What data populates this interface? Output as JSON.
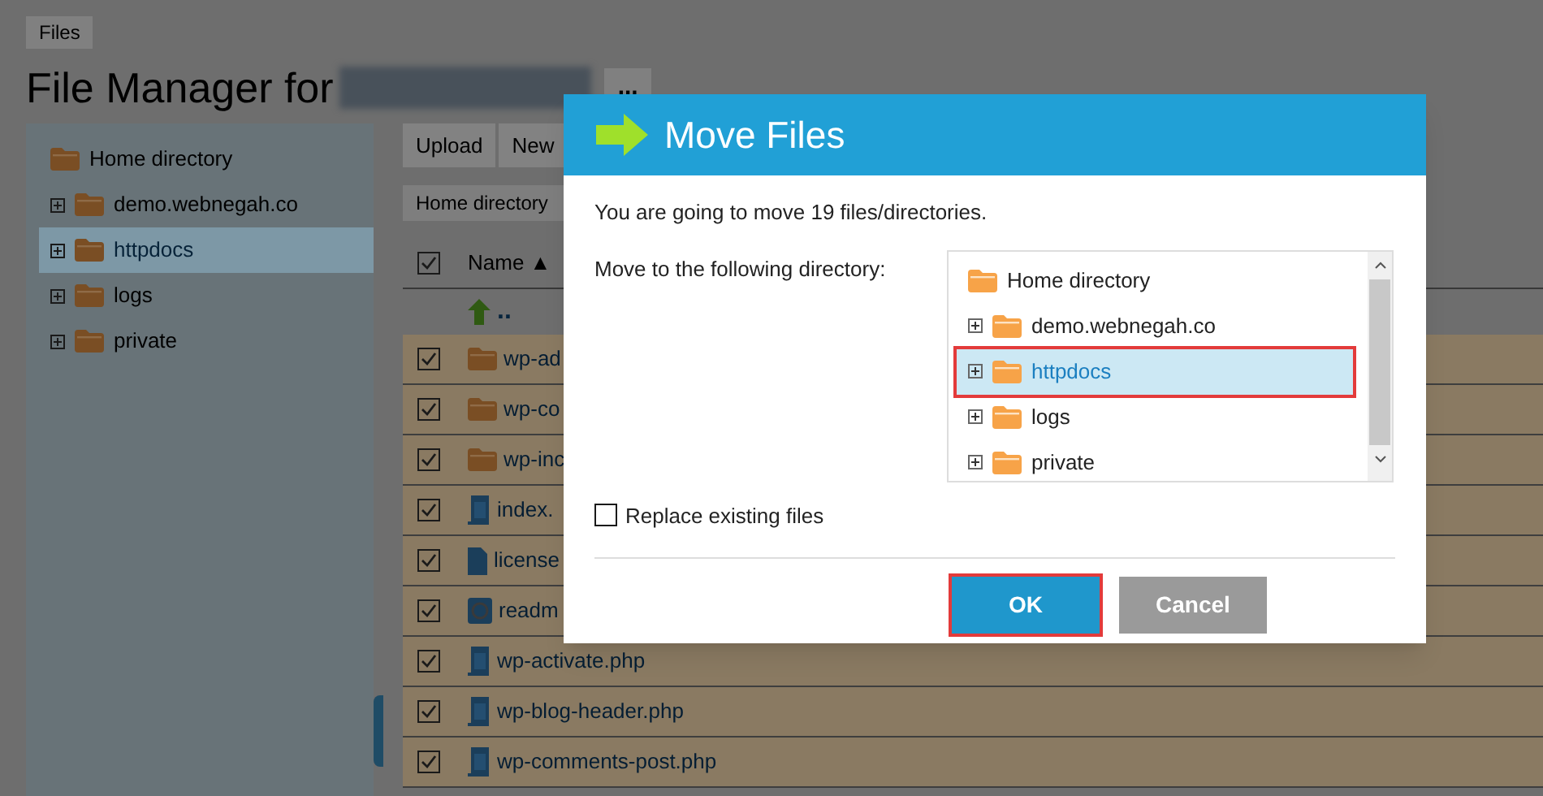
{
  "breadcrumb": "Files",
  "page_title": "File Manager for",
  "more_button": "...",
  "sidebar_tree": [
    {
      "label": "Home directory",
      "expandable": false,
      "selected": false
    },
    {
      "label": "demo.webnegah.co",
      "expandable": true,
      "selected": false
    },
    {
      "label": "httpdocs",
      "expandable": true,
      "selected": true
    },
    {
      "label": "logs",
      "expandable": true,
      "selected": false
    },
    {
      "label": "private",
      "expandable": true,
      "selected": false
    }
  ],
  "toolbar": [
    "Upload",
    "New"
  ],
  "path_bar": "Home directory",
  "table": {
    "header_checked": true,
    "name_column": "Name ▲",
    "parent_row": "..",
    "rows": [
      {
        "name": "wp-ad",
        "kind": "folder",
        "checked": true
      },
      {
        "name": "wp-co",
        "kind": "folder",
        "checked": true
      },
      {
        "name": "wp-inc",
        "kind": "folder",
        "checked": true
      },
      {
        "name": "index.",
        "kind": "php",
        "checked": true
      },
      {
        "name": "license",
        "kind": "text",
        "checked": true
      },
      {
        "name": "readm",
        "kind": "web",
        "checked": true
      },
      {
        "name": "wp-activate.php",
        "kind": "php",
        "checked": true
      },
      {
        "name": "wp-blog-header.php",
        "kind": "php",
        "checked": true
      },
      {
        "name": "wp-comments-post.php",
        "kind": "php",
        "checked": true
      }
    ]
  },
  "dialog": {
    "title": "Move Files",
    "message": "You are going to move 19 files/directories.",
    "target_label": "Move to the following directory:",
    "tree": [
      {
        "label": "Home directory",
        "expandable": false,
        "selected": false,
        "highlighted": false
      },
      {
        "label": "demo.webnegah.co",
        "expandable": true,
        "selected": false,
        "highlighted": false
      },
      {
        "label": "httpdocs",
        "expandable": true,
        "selected": true,
        "highlighted": true
      },
      {
        "label": "logs",
        "expandable": true,
        "selected": false,
        "highlighted": false
      },
      {
        "label": "private",
        "expandable": true,
        "selected": false,
        "highlighted": false
      }
    ],
    "replace_checkbox": {
      "label": "Replace existing files",
      "checked": false
    },
    "buttons": [
      {
        "label": "OK",
        "kind": "primary",
        "highlighted": true
      },
      {
        "label": "Cancel",
        "kind": "secondary",
        "highlighted": false
      }
    ]
  }
}
